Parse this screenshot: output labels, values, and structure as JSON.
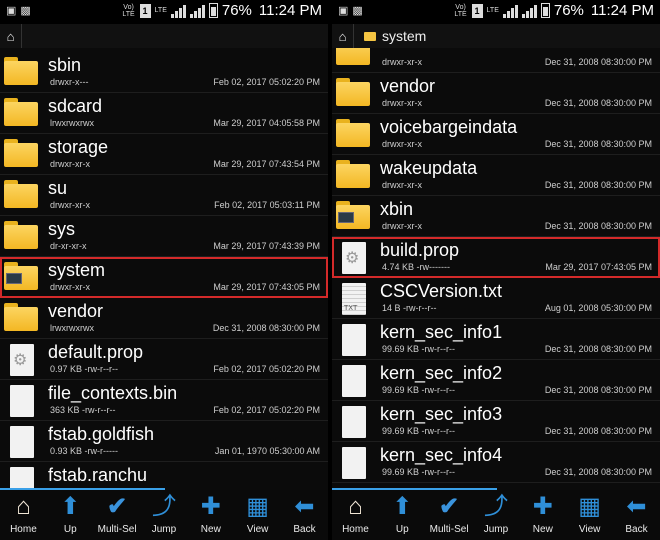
{
  "status": {
    "battery": "76%",
    "time": "11:24 PM",
    "volte": "Vo) LTE",
    "sim": "1",
    "lte": "LTE"
  },
  "left": {
    "path": [],
    "rows": [
      {
        "name": "sbin",
        "meta": "drwxr-x---",
        "date": "Feb 02, 2017 05:02:20 PM",
        "icon": "folder-icon"
      },
      {
        "name": "sdcard",
        "meta": "lrwxrwxrwx",
        "date": "Mar 29, 2017 04:05:58 PM",
        "icon": "folder-icon"
      },
      {
        "name": "storage",
        "meta": "drwxr-xr-x",
        "date": "Mar 29, 2017 07:43:54 PM",
        "icon": "folder-icon"
      },
      {
        "name": "su",
        "meta": "drwxr-xr-x",
        "date": "Feb 02, 2017 05:03:11 PM",
        "icon": "folder-icon"
      },
      {
        "name": "sys",
        "meta": "dr-xr-xr-x",
        "date": "Mar 29, 2017 07:43:39 PM",
        "icon": "folder-icon"
      },
      {
        "name": "system",
        "meta": "drwxr-xr-x",
        "date": "Mar 29, 2017 07:43:05 PM",
        "icon": "system-folder-icon",
        "selected": true
      },
      {
        "name": "vendor",
        "meta": "lrwxrwxrwx",
        "date": "Dec 31, 2008 08:30:00 PM",
        "icon": "folder-icon"
      },
      {
        "name": "default.prop",
        "meta": "0.97 KB -rw-r--r--",
        "date": "Feb 02, 2017 05:02:20 PM",
        "icon": "settings-file-icon"
      },
      {
        "name": "file_contexts.bin",
        "meta": "363 KB -rw-r--r--",
        "date": "Feb 02, 2017 05:02:20 PM",
        "icon": "file-icon"
      },
      {
        "name": "fstab.goldfish",
        "meta": "0.93 KB -rw-r-----",
        "date": "Jan 01, 1970 05:30:00 AM",
        "icon": "file-icon"
      },
      {
        "name": "fstab.ranchu",
        "meta": "",
        "date": "",
        "icon": "file-icon"
      }
    ]
  },
  "right": {
    "path": [
      "system"
    ],
    "rows": [
      {
        "name": "",
        "meta": "drwxr-xr-x",
        "date": "Dec 31, 2008 08:30:00 PM",
        "icon": "folder-icon"
      },
      {
        "name": "vendor",
        "meta": "drwxr-xr-x",
        "date": "Dec 31, 2008 08:30:00 PM",
        "icon": "folder-icon"
      },
      {
        "name": "voicebargeindata",
        "meta": "drwxr-xr-x",
        "date": "Dec 31, 2008 08:30:00 PM",
        "icon": "folder-icon"
      },
      {
        "name": "wakeupdata",
        "meta": "drwxr-xr-x",
        "date": "Dec 31, 2008 08:30:00 PM",
        "icon": "folder-icon"
      },
      {
        "name": "xbin",
        "meta": "drwxr-xr-x",
        "date": "Dec 31, 2008 08:30:00 PM",
        "icon": "system-folder-icon"
      },
      {
        "name": "build.prop",
        "meta": "4.74 KB -rw-------",
        "date": "Mar 29, 2017 07:43:05 PM",
        "icon": "settings-file-icon",
        "selected": true
      },
      {
        "name": "CSCVersion.txt",
        "meta": "14 B -rw-r--r--",
        "date": "Aug 01, 2008 05:30:00 PM",
        "icon": "text-file-icon"
      },
      {
        "name": "kern_sec_info1",
        "meta": "99.69 KB -rw-r--r--",
        "date": "Dec 31, 2008 08:30:00 PM",
        "icon": "file-icon"
      },
      {
        "name": "kern_sec_info2",
        "meta": "99.69 KB -rw-r--r--",
        "date": "Dec 31, 2008 08:30:00 PM",
        "icon": "file-icon"
      },
      {
        "name": "kern_sec_info3",
        "meta": "99.69 KB -rw-r--r--",
        "date": "Dec 31, 2008 08:30:00 PM",
        "icon": "file-icon"
      },
      {
        "name": "kern_sec_info4",
        "meta": "99.69 KB -rw-r--r--",
        "date": "Dec 31, 2008 08:30:00 PM",
        "icon": "file-icon"
      }
    ]
  },
  "toolbar": {
    "items": [
      {
        "label": "Home",
        "icon": "home-icon"
      },
      {
        "label": "Up",
        "icon": "arrow-up-icon"
      },
      {
        "label": "Multi-Sel",
        "icon": "checkmark-icon"
      },
      {
        "label": "Jump",
        "icon": "curved-arrow-icon"
      },
      {
        "label": "New",
        "icon": "plus-icon"
      },
      {
        "label": "View",
        "icon": "grid-icon"
      },
      {
        "label": "Back",
        "icon": "arrow-left-icon"
      }
    ]
  },
  "colors": {
    "accent": "#3aa0e8",
    "selection": "#d42a2a",
    "folder": "#f3b723"
  }
}
